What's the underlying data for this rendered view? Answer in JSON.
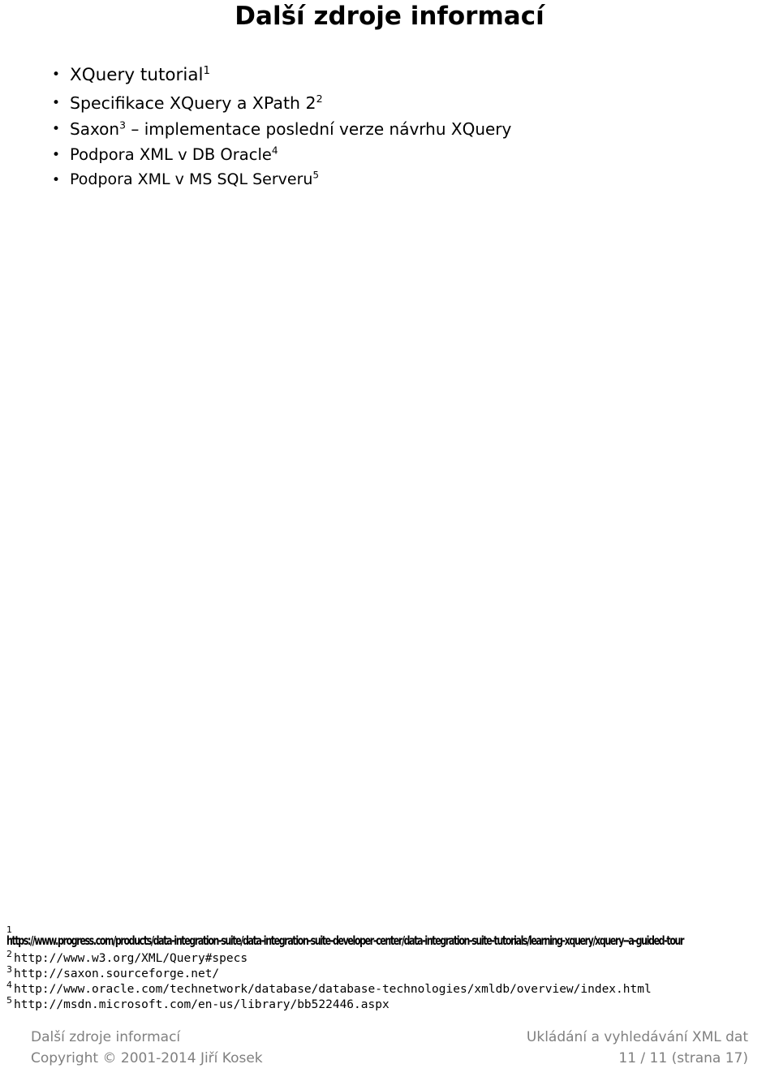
{
  "slide": {
    "title": "Další zdroje informací",
    "bullets": [
      {
        "text": "XQuery tutorial",
        "ref": "1"
      },
      {
        "text": "Specifikace XQuery a XPath 2",
        "ref": "2"
      },
      {
        "text_before": "Saxon",
        "ref": "3",
        "text_after": " – implementace poslední verze návrhu XQuery"
      },
      {
        "text": "Podpora XML v DB Oracle",
        "ref": "4"
      },
      {
        "text": "Podpora XML v MS SQL Serveru",
        "ref": "5"
      }
    ]
  },
  "footnotes": {
    "marker_1": "1",
    "url_1": "https://www.progress.com/products/data-integration-suite/data-integration-suite-developer-center/data-integration-suite-tutorials/learning-xquery/xquery--a-guided-tour",
    "items": [
      {
        "marker": "2",
        "url": "http://www.w3.org/XML/Query#specs"
      },
      {
        "marker": "3",
        "url": "http://saxon.sourceforge.net/"
      },
      {
        "marker": "4",
        "url": "http://www.oracle.com/technetwork/database/database-technologies/xmldb/overview/index.html"
      },
      {
        "marker": "5",
        "url": "http://msdn.microsoft.com/en-us/library/bb522446.aspx"
      }
    ]
  },
  "footer": {
    "left_top": "Další zdroje informací",
    "right_top": "Ukládání a vyhledávání XML dat",
    "left_bottom": "Copyright © 2001-2014 Jiří Kosek",
    "right_bottom": "11 / 11  (strana 17)"
  }
}
